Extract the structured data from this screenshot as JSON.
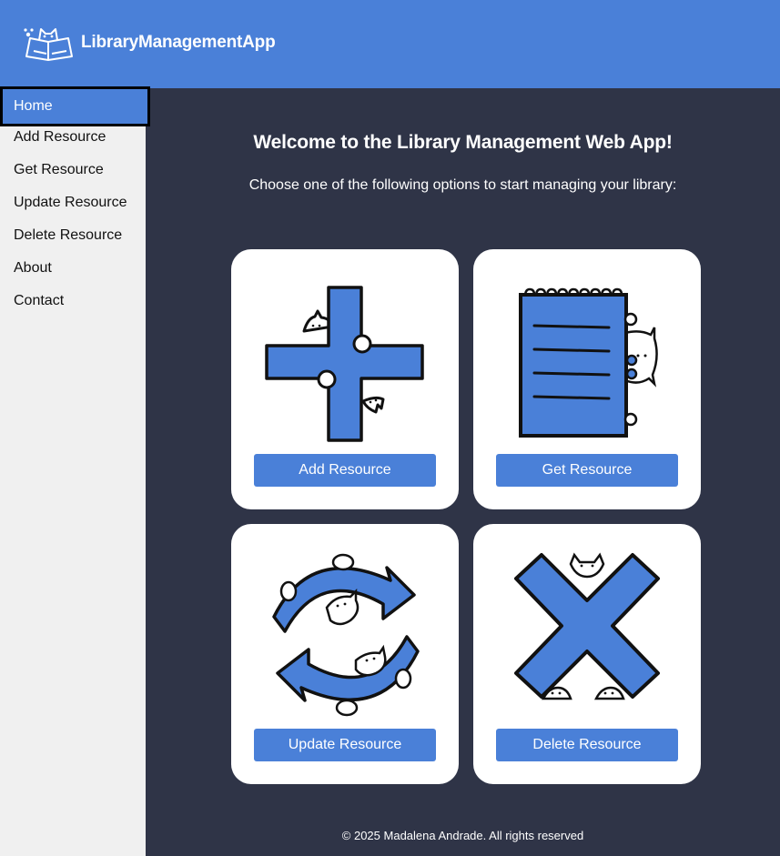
{
  "header": {
    "app_title": "LibraryManagementApp",
    "logo_icon": "book-cat-logo-icon"
  },
  "sidebar": {
    "items": [
      {
        "label": "Home",
        "active": true
      },
      {
        "label": "Add Resource",
        "active": false
      },
      {
        "label": "Get Resource",
        "active": false
      },
      {
        "label": "Update Resource",
        "active": false
      },
      {
        "label": "Delete Resource",
        "active": false
      },
      {
        "label": "About",
        "active": false
      },
      {
        "label": "Contact",
        "active": false
      }
    ]
  },
  "main": {
    "welcome": "Welcome to the Library Management Web App!",
    "subtitle": "Choose one of the following options to start managing your library:",
    "cards": [
      {
        "button": "Add Resource",
        "icon": "plus-cat-icon"
      },
      {
        "button": "Get Resource",
        "icon": "notepad-cat-icon"
      },
      {
        "button": "Update Resource",
        "icon": "refresh-arrows-cat-icon"
      },
      {
        "button": "Delete Resource",
        "icon": "x-cat-icon"
      }
    ]
  },
  "footer": {
    "text": "© 2025 Madalena Andrade. All rights reserved"
  },
  "colors": {
    "accent": "#4a80d8",
    "background": "#2f3447",
    "sidebar": "#f0f0f0"
  }
}
